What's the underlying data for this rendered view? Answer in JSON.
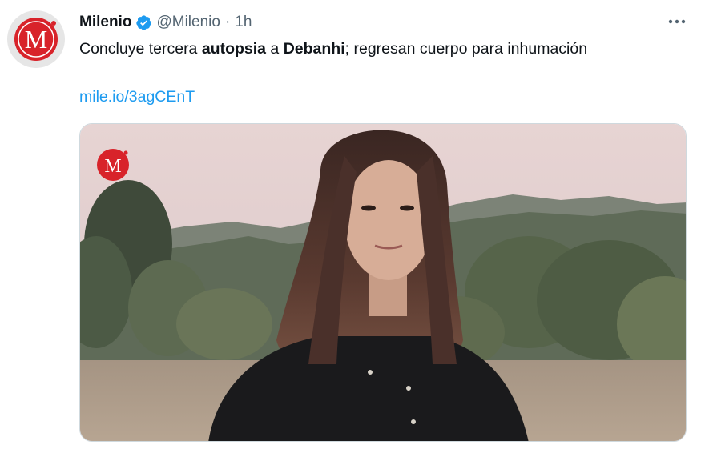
{
  "tweet": {
    "author_name": "Milenio",
    "handle": "@Milenio",
    "separator": "·",
    "time": "1h",
    "text_parts": {
      "t1": "Concluye tercera ",
      "t2": "autopsia",
      "t3": " a ",
      "t4": "Debanhi",
      "t5": "; regresan cuerpo para inhumación"
    },
    "link": "mile.io/3agCEnT",
    "avatar_letter": "M",
    "media_logo_letter": "M"
  },
  "icons": {
    "verified": "verified-badge-icon",
    "more": "more-options-icon"
  },
  "colors": {
    "brand_red": "#d8232a",
    "verified_blue": "#1d9bf0",
    "link_blue": "#1d9bf0",
    "secondary_text": "#536471"
  }
}
